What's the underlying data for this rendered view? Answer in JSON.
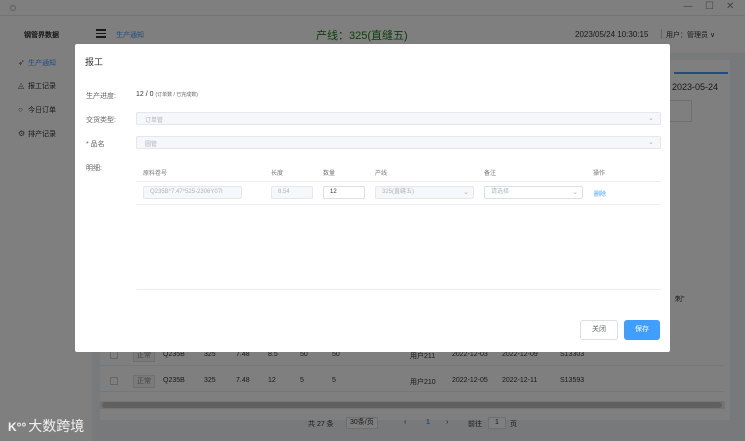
{
  "window": {
    "minimize": "—",
    "maximize": "☐",
    "close": "✕"
  },
  "sidebar": {
    "brand": "钢管界数据",
    "items": [
      {
        "icon": "send-icon",
        "glyph": "➶",
        "label": "生产通知",
        "active": true
      },
      {
        "icon": "bell-icon",
        "glyph": "◬",
        "label": "报工记录",
        "active": false
      },
      {
        "icon": "circle-icon",
        "glyph": "○",
        "label": "今日订单",
        "active": false
      },
      {
        "icon": "gear-icon",
        "glyph": "⚙",
        "label": "排产记录",
        "active": false
      }
    ]
  },
  "header": {
    "breadcrumb": "生产通知",
    "line_title": "产线：325(直缝五)",
    "datetime": "2023/05/24 10:30:15",
    "user": "用户：管理员 ∨"
  },
  "background": {
    "date": "2023-05-24",
    "stray_text": "刺\"",
    "rows": [
      {
        "status": "正常",
        "material": "Q235B",
        "spec": "325",
        "thick": "7.48",
        "len": "8.5",
        "qty1": "50",
        "qty2": "50",
        "user": "用户211",
        "date1": "2022-12-03",
        "date2": "2022-12-09",
        "code": "S13303"
      },
      {
        "status": "正常",
        "material": "Q235B",
        "spec": "325",
        "thick": "7.48",
        "len": "12",
        "qty1": "5",
        "qty2": "5",
        "user": "用户210",
        "date1": "2022-12-05",
        "date2": "2022-12-11",
        "code": "S13593"
      }
    ]
  },
  "pager": {
    "total": "共 27 条",
    "per_page": "30条/页",
    "prev": "‹",
    "page": "1",
    "next": "›",
    "goto": "前往",
    "goto_value": "1",
    "page_unit": "页"
  },
  "dialog": {
    "title": "报工",
    "progress_label": "生产进度:",
    "progress_value": "12 / 0",
    "progress_note": "(订单数 / 已完成数)",
    "type_label": "交货类型:",
    "type_placeholder": "订单管",
    "product_label": "* 品名",
    "product_placeholder": "圆管",
    "detail_label": "明细:",
    "columns": [
      "原料卷号",
      "长度",
      "数量",
      "产线",
      "备注",
      "操作"
    ],
    "row": {
      "coil": "Q235B*7.47*525-2306Y07I",
      "length": "8.54",
      "quantity": "12",
      "line": "325(直缝五)",
      "remark_placeholder": "请选择",
      "action": "删除"
    },
    "close_label": "关闭",
    "save_label": "保存"
  },
  "watermark": {
    "logo": "K°°",
    "text": "大数跨境"
  }
}
